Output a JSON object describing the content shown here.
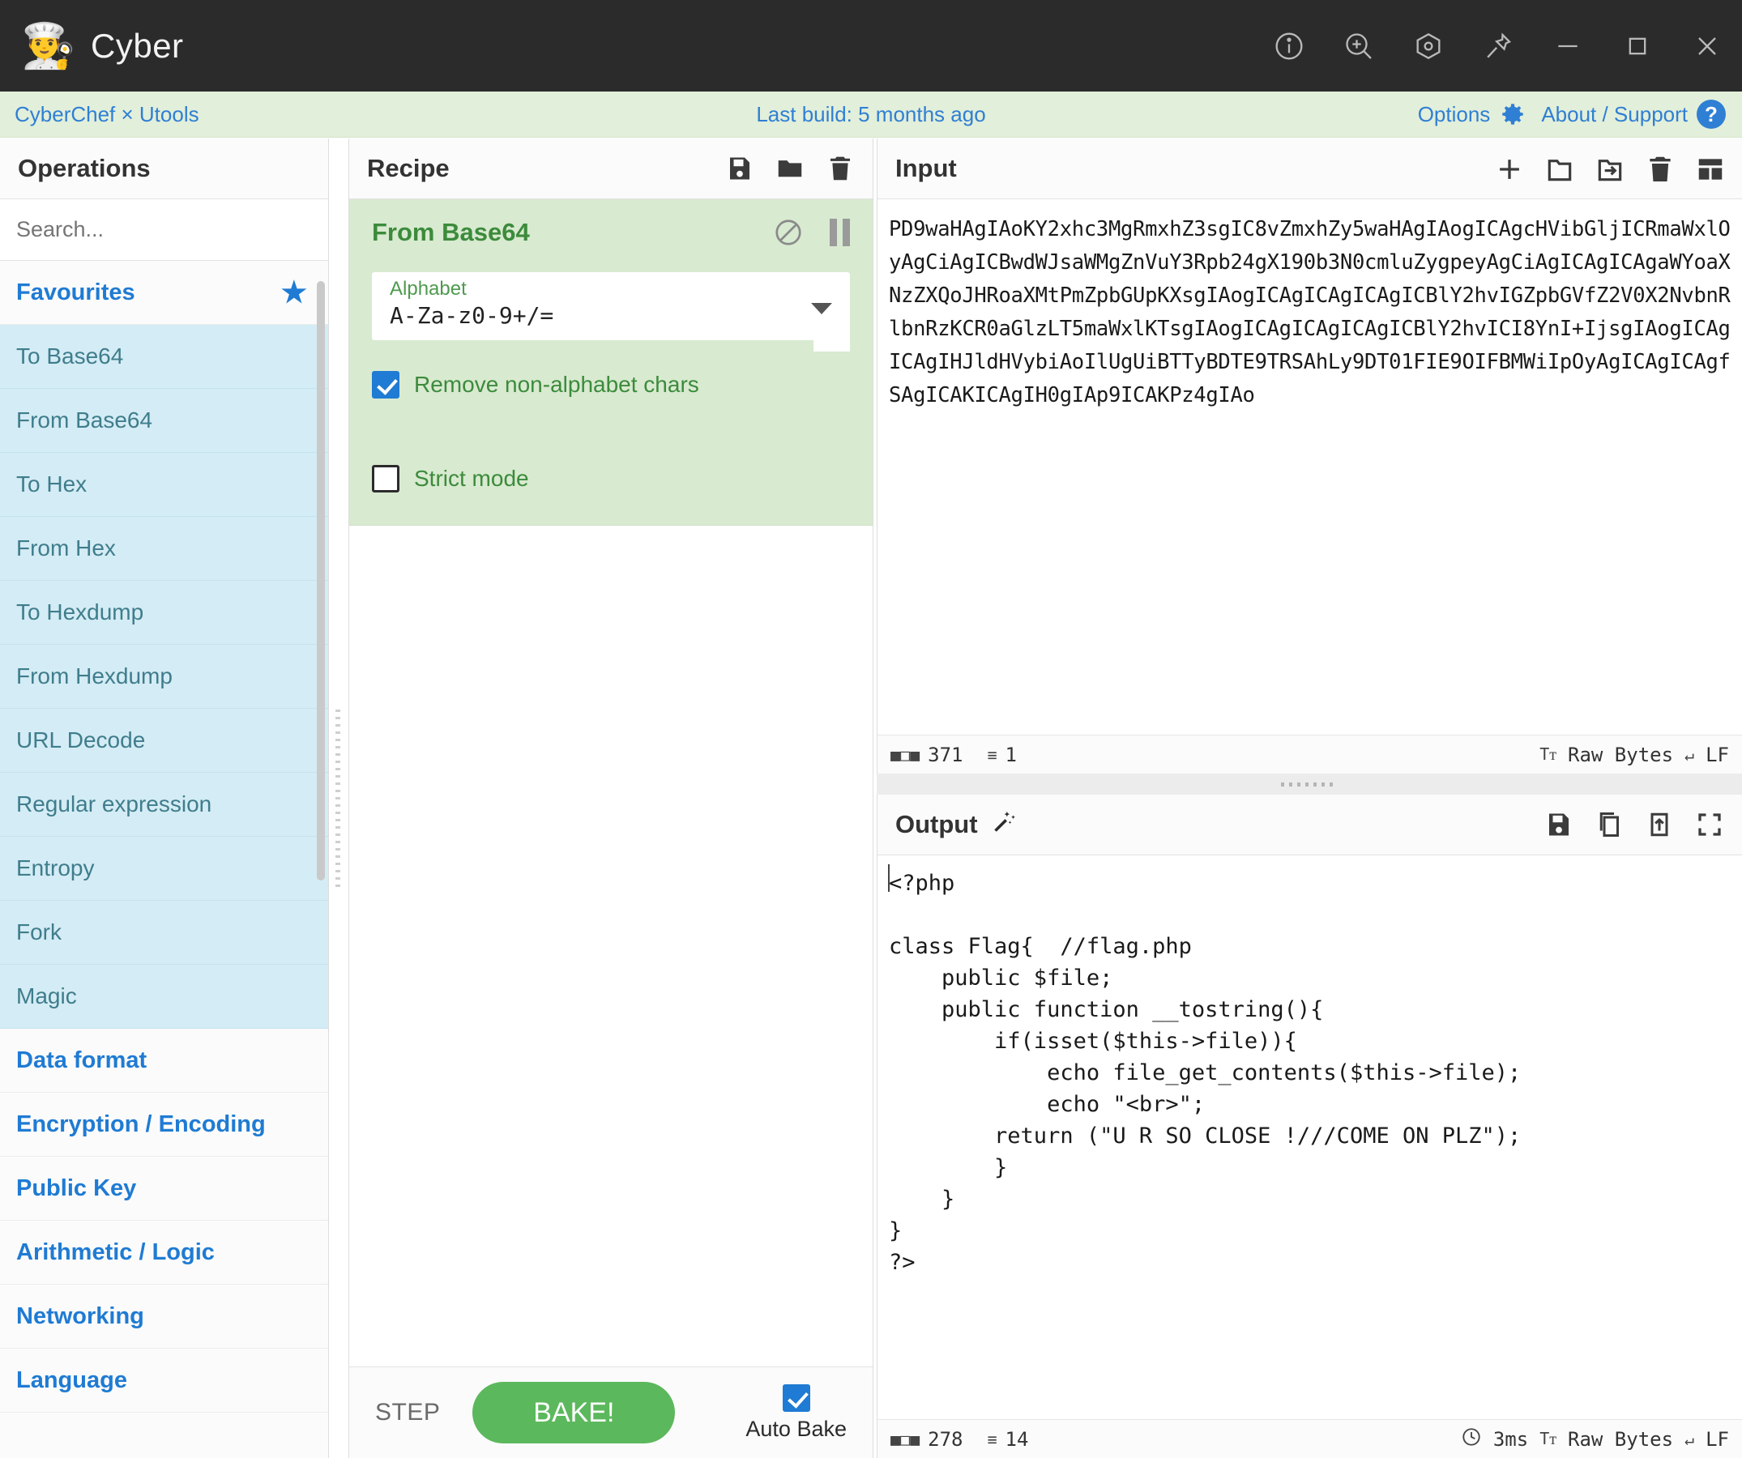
{
  "titlebar": {
    "app_name": "Cyber",
    "chef_icon": "chef-emoji",
    "buttons": [
      {
        "name": "info-icon",
        "label": "i"
      },
      {
        "name": "zoom-in-icon",
        "label": "+"
      },
      {
        "name": "devtools-icon",
        "label": "o"
      },
      {
        "name": "pin-icon",
        "label": "pin"
      },
      {
        "name": "minimize-icon",
        "label": "-"
      },
      {
        "name": "maximize-icon",
        "label": "□"
      },
      {
        "name": "close-icon",
        "label": "×"
      }
    ]
  },
  "banner": {
    "left_link": "CyberChef × Utools",
    "center_text": "Last build: 5 months ago",
    "options_label": "Options",
    "about_label": "About / Support",
    "help_glyph": "?",
    "link_color": "#2f7fd4",
    "background": "#e2efda"
  },
  "operations": {
    "title": "Operations",
    "search_placeholder": "Search...",
    "search_value": "",
    "favourites_label": "Favourites",
    "star_glyph": "★",
    "items": [
      {
        "label": "To Base64"
      },
      {
        "label": "From Base64"
      },
      {
        "label": "To Hex"
      },
      {
        "label": "From Hex"
      },
      {
        "label": "To Hexdump"
      },
      {
        "label": "From Hexdump"
      },
      {
        "label": "URL Decode"
      },
      {
        "label": "Regular expression"
      },
      {
        "label": "Entropy"
      },
      {
        "label": "Fork"
      },
      {
        "label": "Magic"
      }
    ],
    "categories": [
      {
        "label": "Data format"
      },
      {
        "label": "Encryption / Encoding"
      },
      {
        "label": "Public Key"
      },
      {
        "label": "Arithmetic / Logic"
      },
      {
        "label": "Networking"
      },
      {
        "label": "Language"
      }
    ],
    "item_bg": "#d4ecf5",
    "item_color": "#3f7d8c"
  },
  "recipe": {
    "title": "Recipe",
    "header_icons": [
      {
        "name": "save-recipe-icon"
      },
      {
        "name": "load-recipe-icon"
      },
      {
        "name": "clear-recipe-icon"
      }
    ],
    "operation": {
      "name": "From Base64",
      "disable_icon": "disable-icon",
      "breakpoint_icon": "pause-icon",
      "arg_label": "Alphabet",
      "arg_value": "A-Za-z0-9+/=",
      "checkboxes": [
        {
          "label": "Remove non-alphabet chars",
          "checked": true
        },
        {
          "label": "Strict mode",
          "checked": false
        }
      ]
    },
    "controls": {
      "step_label": "STEP",
      "bake_label": "BAKE!",
      "auto_bake_label": "Auto Bake",
      "auto_bake_checked": true,
      "bake_color": "#5cb85c"
    }
  },
  "input": {
    "title": "Input",
    "header_icons": [
      {
        "name": "add-input-tab-icon"
      },
      {
        "name": "open-folder-icon"
      },
      {
        "name": "open-folder-as-input-icon"
      },
      {
        "name": "clear-input-icon"
      },
      {
        "name": "input-tabs-icon"
      }
    ],
    "value": "PD9waHAgIAoKY2xhc3MgRmxhZ3sgIC8vZmxhZy5waHAgIAogICAgcHVibGljICRmaWxlOyAgCiAgICBwdWJsaWMgZnVuY3Rpb24gX190b3N0cmluZygpeyAgCiAgICAgICAgaWYoaXNzZXQoJHRoaXMtPmZpbGUpKXsgIAogICAgICAgICAgICBlY2hvIGZpbGVfZ2V0X2NvbnRlbnRzKCR0aGlzLT5maWxlKTsgIAogICAgICAgICAgICBlY2hvICI8YnI+IjsgIAogICAgICAgIHJldHVybiAoIlUgUiBTTyBDTE9TRSAhLy9DT01FIE9OIFBMWiIpOyAgICAgICAgfSAgICAKICAgIH0gIAp9ICAKPz4gIAo",
    "status": {
      "length_icon": "abc-icon",
      "length": "371",
      "lines_icon": "lines-icon",
      "lines": "1",
      "encoding_icon": "font-icon",
      "encoding": "Raw Bytes",
      "eol_icon": "return-icon",
      "eol": "LF"
    }
  },
  "output": {
    "title": "Output",
    "magic_icon": "magic-wand-icon",
    "header_icons": [
      {
        "name": "save-output-icon"
      },
      {
        "name": "copy-output-icon"
      },
      {
        "name": "replace-input-icon"
      },
      {
        "name": "maximise-output-icon"
      }
    ],
    "value": "<?php\n\nclass Flag{  //flag.php\n    public $file;\n    public function __tostring(){\n        if(isset($this->file)){\n            echo file_get_contents($this->file);\n            echo \"<br>\";\n        return (\"U R SO CLOSE !///COME ON PLZ\");\n        }\n    }\n}\n?>",
    "status": {
      "length_icon": "abc-icon",
      "length": "278",
      "lines_icon": "lines-icon",
      "lines": "14",
      "time_icon": "clock-icon",
      "time": "3ms",
      "encoding_icon": "font-icon",
      "encoding": "Raw Bytes",
      "eol_icon": "return-icon",
      "eol": "LF"
    }
  }
}
